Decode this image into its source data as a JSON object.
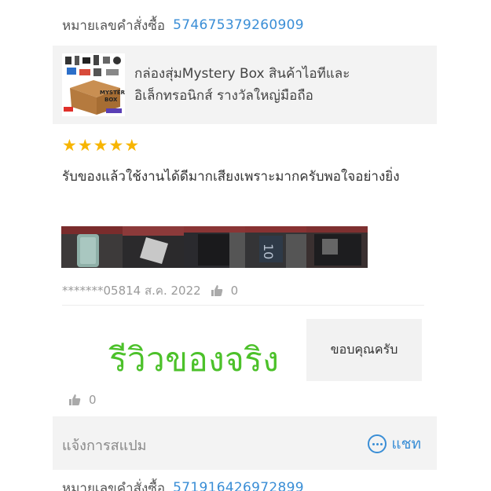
{
  "order_top": {
    "label": "หมายเลขคำสั่งซื้อ",
    "number": "574675379260909"
  },
  "product": {
    "name_line1": "กล่องสุ่มMystery Box สินค้าไอทีและ",
    "name_line2": "อิเล็กทรอนิกส์ รางวัลใหญ่มือถือ",
    "thumb_text": "MYSTERY BOX"
  },
  "rating": {
    "stars": 5,
    "max": 5,
    "star_glyph": "★"
  },
  "review": {
    "text": "รับของแล้วใช้งานได้ดีมากเสียงเพราะมากครับพอใจอย่างยิ่ง"
  },
  "meta": {
    "user_date": "*******05814 ส.ค. 2022",
    "likes": "0"
  },
  "stamp": {
    "text": "รีวิวของจริง"
  },
  "reply": {
    "text": "ขอบคุณครับ"
  },
  "reply_likes": "0",
  "footer": {
    "report": "แจ้งการสแปม",
    "chat": "แชท"
  },
  "order_bottom": {
    "label": "หมายเลขคำสั่งซื้อ",
    "number": "571916426972899"
  },
  "colors": {
    "accent": "#3a8ed6",
    "star": "#f7b500",
    "stamp": "#4cc12a"
  }
}
